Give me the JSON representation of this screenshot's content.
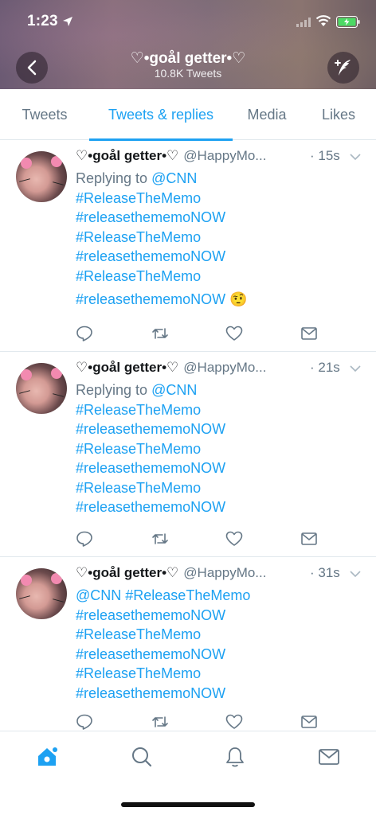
{
  "status": {
    "time": "1:23"
  },
  "header": {
    "title": "♡•goål getter•♡",
    "subtitle": "10.8K Tweets"
  },
  "tabs": [
    {
      "label": "Tweets"
    },
    {
      "label": "Tweets & replies"
    },
    {
      "label": "Media"
    },
    {
      "label": "Likes"
    }
  ],
  "tweets": [
    {
      "name": "♡•goål getter•♡",
      "handle": "@HappyMo...",
      "time": "· 15s",
      "reply_prefix": "Replying to ",
      "reply_to": "@CNN",
      "lines": [
        "#ReleaseTheMemo",
        "#releasethememoNOW",
        "#ReleaseTheMemo",
        "#releasethememoNOW",
        "#ReleaseTheMemo",
        "#releasethememoNOW"
      ],
      "emoji": "🤨"
    },
    {
      "name": "♡•goål getter•♡",
      "handle": "@HappyMo...",
      "time": "· 21s",
      "reply_prefix": "Replying to ",
      "reply_to": "@CNN",
      "lines": [
        "#ReleaseTheMemo",
        "#releasethememoNOW",
        "#ReleaseTheMemo",
        "#releasethememoNOW",
        "#ReleaseTheMemo",
        "#releasethememoNOW"
      ]
    },
    {
      "name": "♡•goål getter•♡",
      "handle": "@HappyMo...",
      "time": "· 31s",
      "first_line": "@CNN #ReleaseTheMemo",
      "lines": [
        "#releasethememoNOW",
        "#ReleaseTheMemo",
        "#releasethememoNOW",
        "#ReleaseTheMemo",
        "#releasethememoNOW"
      ]
    }
  ],
  "colors": {
    "accent": "#1da1f2",
    "muted": "#657786",
    "text": "#14171a"
  },
  "icons": {
    "header": [
      "back-arrow-icon",
      "compose-tweet-icon"
    ],
    "tweet_actions": [
      "reply-icon",
      "retweet-icon",
      "like-icon",
      "direct-message-icon"
    ],
    "bottom_bar": [
      "home-icon",
      "search-icon",
      "notifications-icon",
      "messages-icon"
    ]
  }
}
